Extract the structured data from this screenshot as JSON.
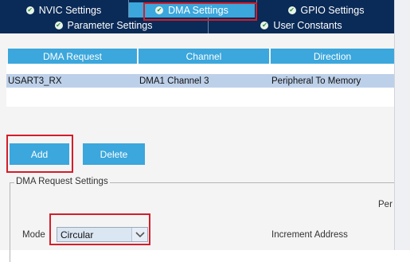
{
  "tabs_row1": [
    {
      "label": "NVIC Settings",
      "icon": "check-circle-icon"
    },
    {
      "label": "DMA Settings",
      "icon": "check-circle-icon"
    },
    {
      "label": "GPIO Settings",
      "icon": "check-circle-icon"
    }
  ],
  "tabs_row2": [
    {
      "label": "Parameter Settings",
      "icon": "check-circle-icon"
    },
    {
      "label": "User Constants",
      "icon": "check-circle-icon"
    }
  ],
  "table": {
    "columns": [
      "DMA Request",
      "Channel",
      "Direction"
    ],
    "rows": [
      [
        "USART3_RX",
        "DMA1 Channel 3",
        "Peripheral To Memory"
      ]
    ]
  },
  "buttons": {
    "add": "Add",
    "delete": "Delete"
  },
  "settings": {
    "legend": "DMA Request Settings",
    "per_label": "Per",
    "mode_label": "Mode",
    "mode_value": "Circular",
    "increment_label": "Increment Address"
  },
  "colors": {
    "accent": "#3ba7dc",
    "navy": "#0a2a57",
    "highlight": "#d31e2b",
    "row_selected": "#bdd0e9"
  }
}
